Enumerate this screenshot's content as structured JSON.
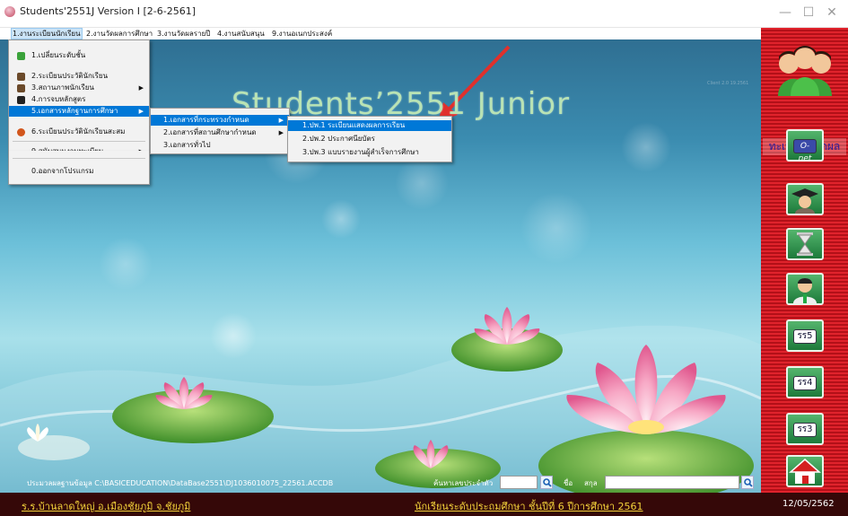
{
  "window": {
    "title": "Students'2551J Version I [2-6-2561]",
    "minimize": "—",
    "maximize": "☐",
    "close": "✕"
  },
  "menubar": {
    "items": [
      {
        "label": "1.งานระเบียนนักเรียน"
      },
      {
        "label": "2.งานวัดผลการศึกษา"
      },
      {
        "label": "3.งานวัดผลรายปี"
      },
      {
        "label": "4.งานสนับสนุน"
      },
      {
        "label": "9.งานอเนกประสงค์"
      }
    ]
  },
  "main_menu": {
    "items": [
      {
        "label": "1.เปลี่ยนระดับชั้น"
      },
      {
        "label": "2.ระเบียนประวัตินักเรียน"
      },
      {
        "label": "3.สถานภาพนักเรียน"
      },
      {
        "label": "4.การจบหลักสูตร"
      },
      {
        "label": "5.เอกสารหลักฐานการศึกษา"
      },
      {
        "label": "6.ระเบียนประวัตินักเรียนสะสม"
      },
      {
        "label": "9.สนับสนุนงานทะเบียน"
      },
      {
        "label": "0.ออกจากโปรแกรม"
      }
    ]
  },
  "submenu_docs": {
    "items": [
      {
        "label": "1.เอกสารที่กระทรวงกำหนด"
      },
      {
        "label": "2.เอกสารที่สถานศึกษากำหนด"
      },
      {
        "label": "3.เอกสารทั่วไป"
      }
    ]
  },
  "submenu_ministry": {
    "items": [
      {
        "label": "1.ปพ.1 ระเบียนแสดงผลการเรียน"
      },
      {
        "label": "2.ปพ.2 ประกาศนียบัตร"
      },
      {
        "label": "3.ปพ.3 แบบรายงานผู้สำเร็จการศึกษา"
      }
    ]
  },
  "background": {
    "headline": "Students’2551 Junior",
    "version_badge": "Client 2.0 19.2561"
  },
  "footer_info": {
    "db_path": "ประมวลผลฐานข้อมูล C:\\BASICEDUCATION\\DataBase2551\\DJ1036010075_22561.ACCDB",
    "search_id_label": "ค้นหาเลขประจำตัว",
    "name_label": "ชื่อ",
    "surname_label": "สกุล"
  },
  "statusbar": {
    "school": "ร.ร.บ้านลาดใหญ่  อ.เมืองชัยภูมิ  จ.ชัยภูมิ",
    "level": "นักเรียนระดับประถมศึกษา  ชั้นปีที่ 6  ปีการศึกษา 2561",
    "date": "12/05/2562"
  },
  "right_panel": {
    "title": "ทะเบียน&วัดผล",
    "buttons": [
      {
        "label": "O-net",
        "icon": "onet-icon"
      },
      {
        "label": "",
        "icon": "graduate-icon"
      },
      {
        "label": "",
        "icon": "hourglass-icon"
      },
      {
        "label": "",
        "icon": "teacher-icon"
      },
      {
        "label": "รร5",
        "icon": "report-icon"
      },
      {
        "label": "รร4",
        "icon": "report-icon"
      },
      {
        "label": "รร3",
        "icon": "report-icon"
      },
      {
        "label": "",
        "icon": "home-icon"
      }
    ]
  },
  "colors": {
    "accent": "#0078d7",
    "status_bg": "#350808",
    "status_text": "#f3d33a",
    "panel_red": "#c4141c"
  }
}
